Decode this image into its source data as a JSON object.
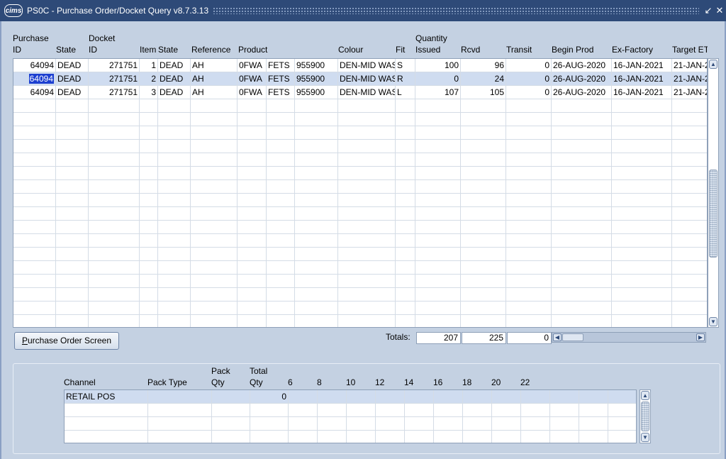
{
  "window": {
    "logo": "cims",
    "title": "PS0C - Purchase Order/Docket Query v8.7.3.13",
    "minimize_glyph": "↙",
    "close_glyph": "✕"
  },
  "grid": {
    "headers": {
      "purchase_id_top": "Purchase",
      "purchase_id_bottom": "ID",
      "state": "State",
      "docket_id_top": "Docket",
      "docket_id_bottom": "ID",
      "item": "Item",
      "item_state": "State",
      "reference": "Reference",
      "product": "Product",
      "colour": "Colour",
      "fit": "Fit",
      "quantity_issued_top": "Quantity",
      "quantity_issued_bottom": "Issued",
      "rcvd": "Rcvd",
      "transit": "Transit",
      "begin_prod": "Begin Prod",
      "ex_factory": "Ex-Factory",
      "target": "Target ET"
    },
    "rows": [
      {
        "purchase_id": "64094",
        "state": "DEAD",
        "docket_id": "271751",
        "item": "1",
        "item_state": "DEAD",
        "reference": "AH",
        "product1": "0FWA",
        "product2": "FETS",
        "product3": "955900",
        "colour": "DEN-MID WAS",
        "fit": "S",
        "issued": "100",
        "rcvd": "96",
        "transit": "0",
        "begin_prod": "26-AUG-2020",
        "ex_factory": "16-JAN-2021",
        "target": "21-JAN-2"
      },
      {
        "purchase_id": "64094",
        "state": "DEAD",
        "docket_id": "271751",
        "item": "2",
        "item_state": "DEAD",
        "reference": "AH",
        "product1": "0FWA",
        "product2": "FETS",
        "product3": "955900",
        "colour": "DEN-MID WAS",
        "fit": "R",
        "issued": "0",
        "rcvd": "24",
        "transit": "0",
        "begin_prod": "26-AUG-2020",
        "ex_factory": "16-JAN-2021",
        "target": "21-JAN-2"
      },
      {
        "purchase_id": "64094",
        "state": "DEAD",
        "docket_id": "271751",
        "item": "3",
        "item_state": "DEAD",
        "reference": "AH",
        "product1": "0FWA",
        "product2": "FETS",
        "product3": "955900",
        "colour": "DEN-MID WAS",
        "fit": "L",
        "issued": "107",
        "rcvd": "105",
        "transit": "0",
        "begin_prod": "26-AUG-2020",
        "ex_factory": "16-JAN-2021",
        "target": "21-JAN-2"
      }
    ],
    "empty_rows": 17
  },
  "purchase_order_button": {
    "accel": "P",
    "rest": "urchase Order Screen"
  },
  "totals": {
    "label": "Totals:",
    "issued": "207",
    "rcvd": "225",
    "transit": "0"
  },
  "channel_grid": {
    "headers": {
      "channel": "Channel",
      "pack_type": "Pack Type",
      "pack_qty_top": "Pack",
      "pack_qty_bottom": "Qty",
      "total_qty_top": "Total",
      "total_qty_bottom": "Qty",
      "sizes": [
        "6",
        "8",
        "10",
        "12",
        "14",
        "16",
        "18",
        "20",
        "22"
      ]
    },
    "rows": [
      {
        "channel": "RETAIL POS",
        "pack_type": "",
        "pack_qty": "",
        "total_qty": "0"
      }
    ],
    "empty_rows": 3
  },
  "icons": {
    "scroll_up": "▲",
    "scroll_down": "▼",
    "scroll_left": "◀",
    "scroll_right": "▶"
  }
}
